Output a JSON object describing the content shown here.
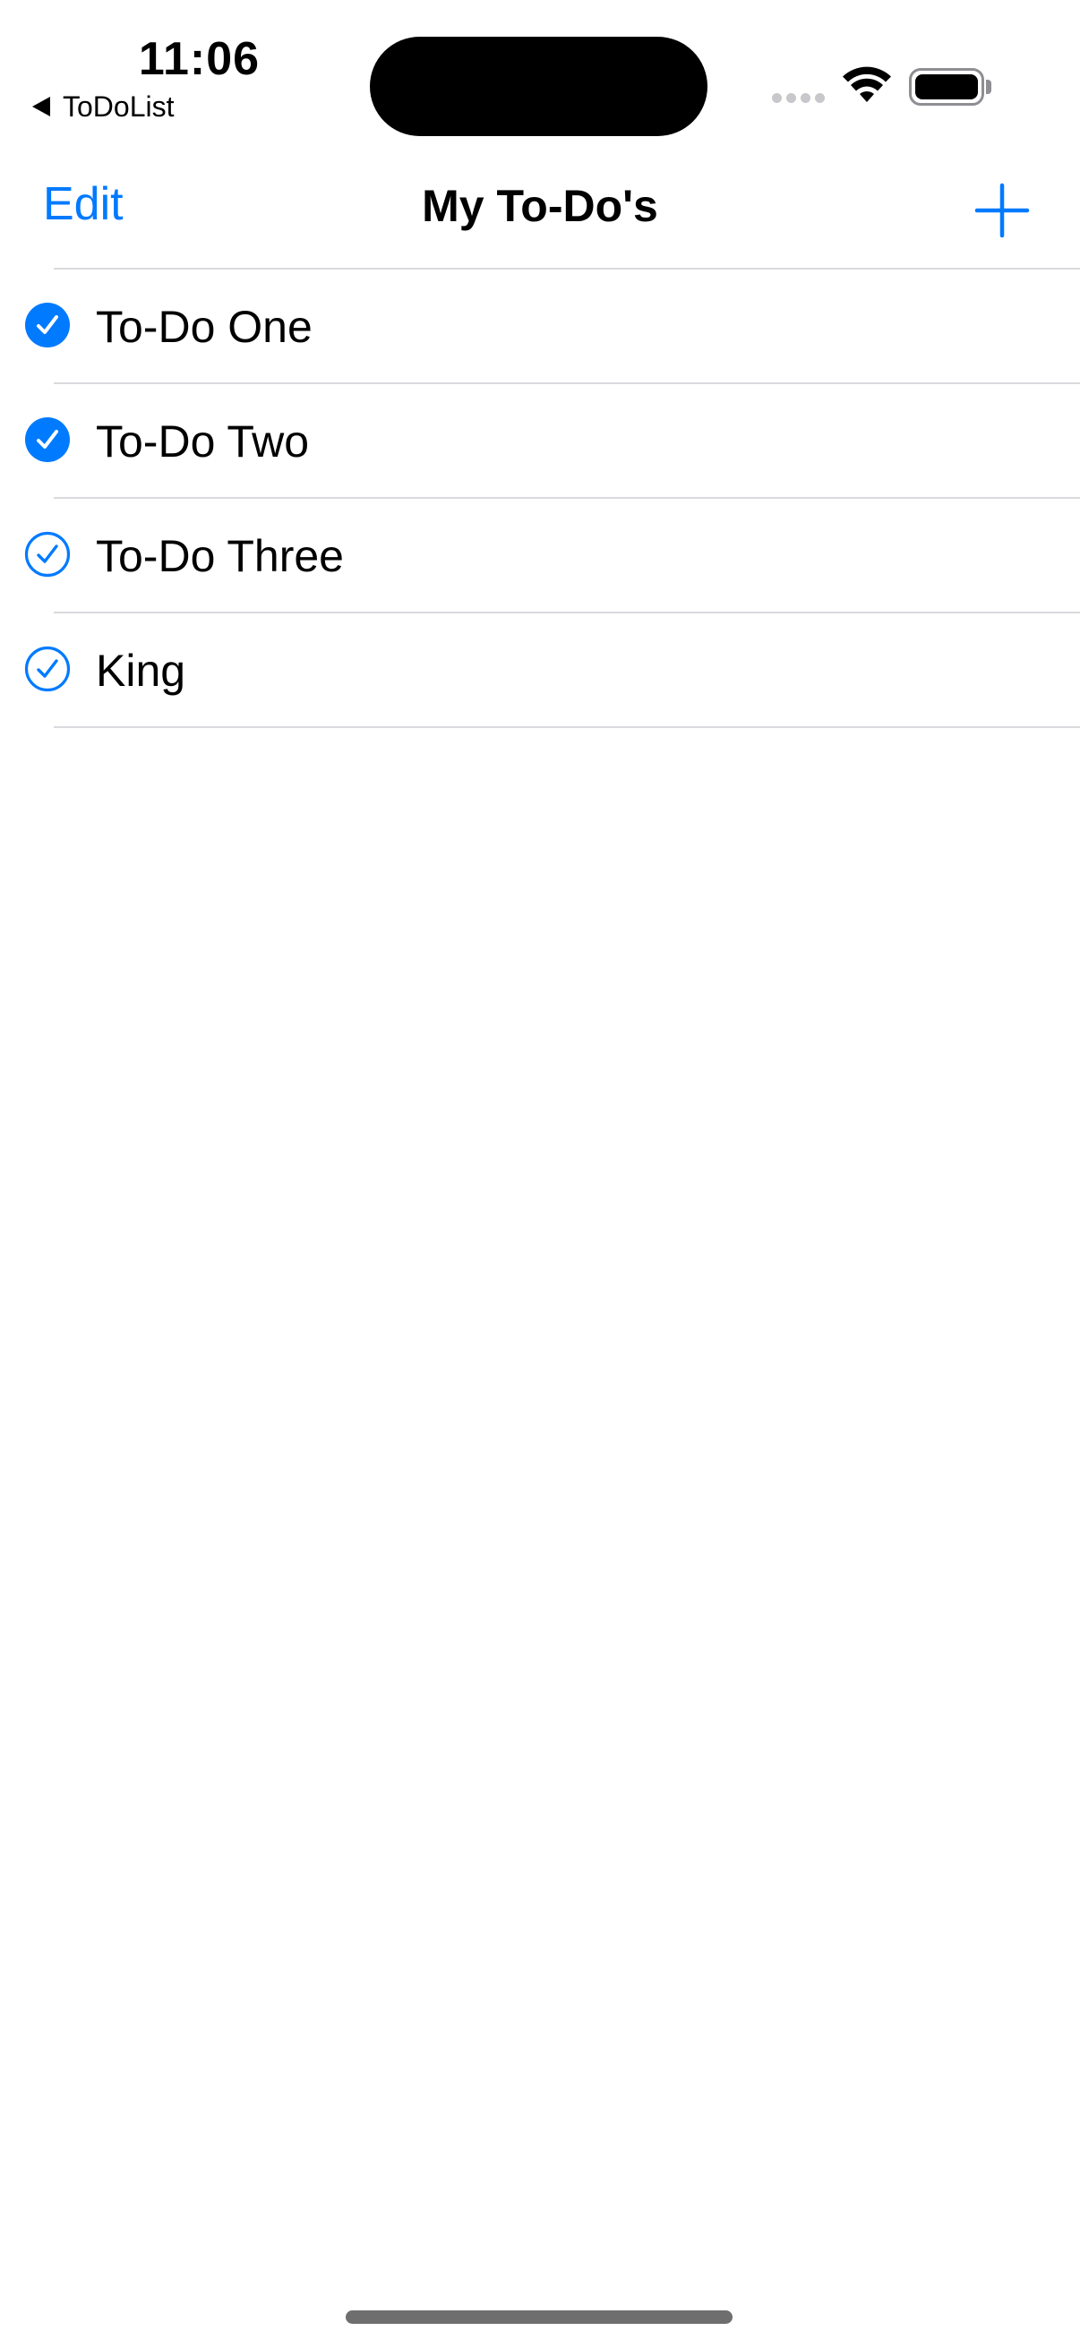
{
  "status_bar": {
    "time": "11:06",
    "back_app": "ToDoList",
    "back_icon": "back-triangle-icon",
    "wifi_icon": "wifi-icon",
    "battery_icon": "battery-icon",
    "battery_level": 1.0
  },
  "nav": {
    "edit_label": "Edit",
    "title": "My To-Do's",
    "add_icon": "plus-icon"
  },
  "colors": {
    "accent": "#007aff",
    "separator": "#d9d9de",
    "text": "#000000",
    "background": "#ffffff"
  },
  "todos": [
    {
      "label": "To-Do One",
      "completed": true
    },
    {
      "label": "To-Do Two",
      "completed": true
    },
    {
      "label": "To-Do Three",
      "completed": false
    },
    {
      "label": "King",
      "completed": false
    }
  ]
}
